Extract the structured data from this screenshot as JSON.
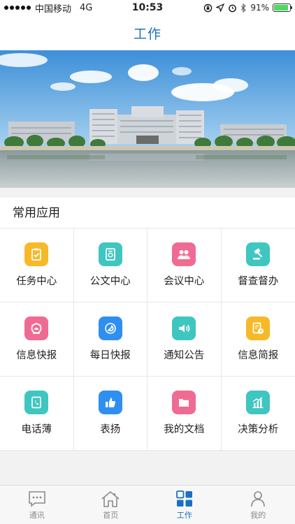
{
  "status_bar": {
    "carrier": "中国移动",
    "network": "4G",
    "time": "10:53",
    "battery_percent": "91%",
    "battery_level": 0.91
  },
  "nav": {
    "title": "工作"
  },
  "section": {
    "title": "常用应用"
  },
  "apps": [
    {
      "label": "任务中心",
      "icon": "task-clipboard-icon",
      "color": "#f7b928"
    },
    {
      "label": "公文中心",
      "icon": "document-icon",
      "color": "#3fc6c0"
    },
    {
      "label": "会议中心",
      "icon": "meeting-people-icon",
      "color": "#f06b92"
    },
    {
      "label": "督查督办",
      "icon": "gavel-icon",
      "color": "#3fc6c0"
    },
    {
      "label": "信息快报",
      "icon": "alarm-icon",
      "color": "#f06b92"
    },
    {
      "label": "每日快报",
      "icon": "party-emblem-icon",
      "color": "#2e8ff0"
    },
    {
      "label": "通知公告",
      "icon": "speaker-icon",
      "color": "#3fc6c0"
    },
    {
      "label": "信息简报",
      "icon": "report-clock-icon",
      "color": "#f7b928"
    },
    {
      "label": "电话薄",
      "icon": "phone-book-icon",
      "color": "#3fc6c0"
    },
    {
      "label": "表扬",
      "icon": "thumbs-up-icon",
      "color": "#2e8ff0"
    },
    {
      "label": "我的文档",
      "icon": "folder-icon",
      "color": "#f06b92"
    },
    {
      "label": "决策分析",
      "icon": "bar-chart-icon",
      "color": "#3fc6c0"
    }
  ],
  "tabs": [
    {
      "label": "通讯",
      "icon": "message-icon",
      "active": false
    },
    {
      "label": "首页",
      "icon": "home-icon",
      "active": false
    },
    {
      "label": "工作",
      "icon": "grid-icon",
      "active": true
    },
    {
      "label": "我的",
      "icon": "person-icon",
      "active": false
    }
  ],
  "colors": {
    "accent": "#1b6fc2",
    "tab_inactive": "#8a8a8a"
  }
}
